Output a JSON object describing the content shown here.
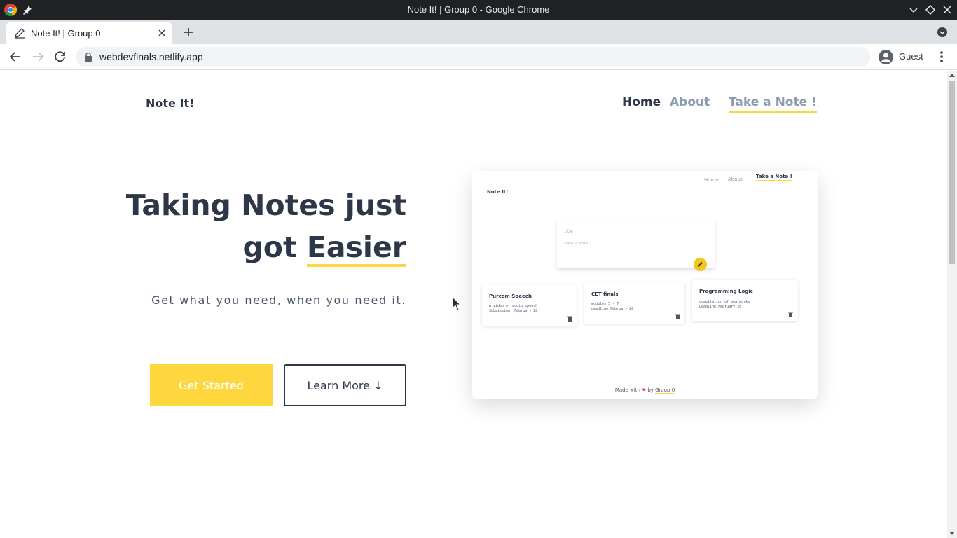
{
  "window": {
    "title": "Note It! | Group 0 - Google Chrome"
  },
  "tab": {
    "title": "Note It! | Group 0"
  },
  "omnibox": {
    "url": "webdevfinals.netlify.app"
  },
  "profile": {
    "label": "Guest"
  },
  "site": {
    "brand": "Note It!",
    "nav": {
      "home": "Home",
      "about": "About",
      "take_note": "Take a Note !"
    },
    "hero": {
      "line1": "Taking Notes just",
      "line2_a": "got ",
      "line2_b": "Easier"
    },
    "tagline": "Get what you need, when you need it.",
    "buttons": {
      "get_started": "Get Started",
      "learn_more": "Learn More ↓"
    }
  },
  "preview": {
    "brand": "Note It!",
    "nav": {
      "home": "Home",
      "about": "About",
      "take_note": "Take a Note !"
    },
    "form": {
      "title": "title",
      "placeholder": "Take a note..."
    },
    "cards": [
      {
        "title": "Purcom Speech",
        "lines": [
          "A video or audio speech",
          "Submission: February 28"
        ]
      },
      {
        "title": "CET finals",
        "lines": [
          "modules 5 - 7",
          "deadline February 26"
        ]
      },
      {
        "title": "Programming Logic",
        "lines": [
          "compilation of seatworks",
          "Deadline February 26"
        ]
      }
    ],
    "footer": {
      "prefix": "Made with",
      "heart": "❤",
      "by": "by",
      "group": "Group 0"
    }
  },
  "colors": {
    "accent": "#fed73f",
    "text": "#2d3748",
    "muted": "#8b9bb0"
  }
}
